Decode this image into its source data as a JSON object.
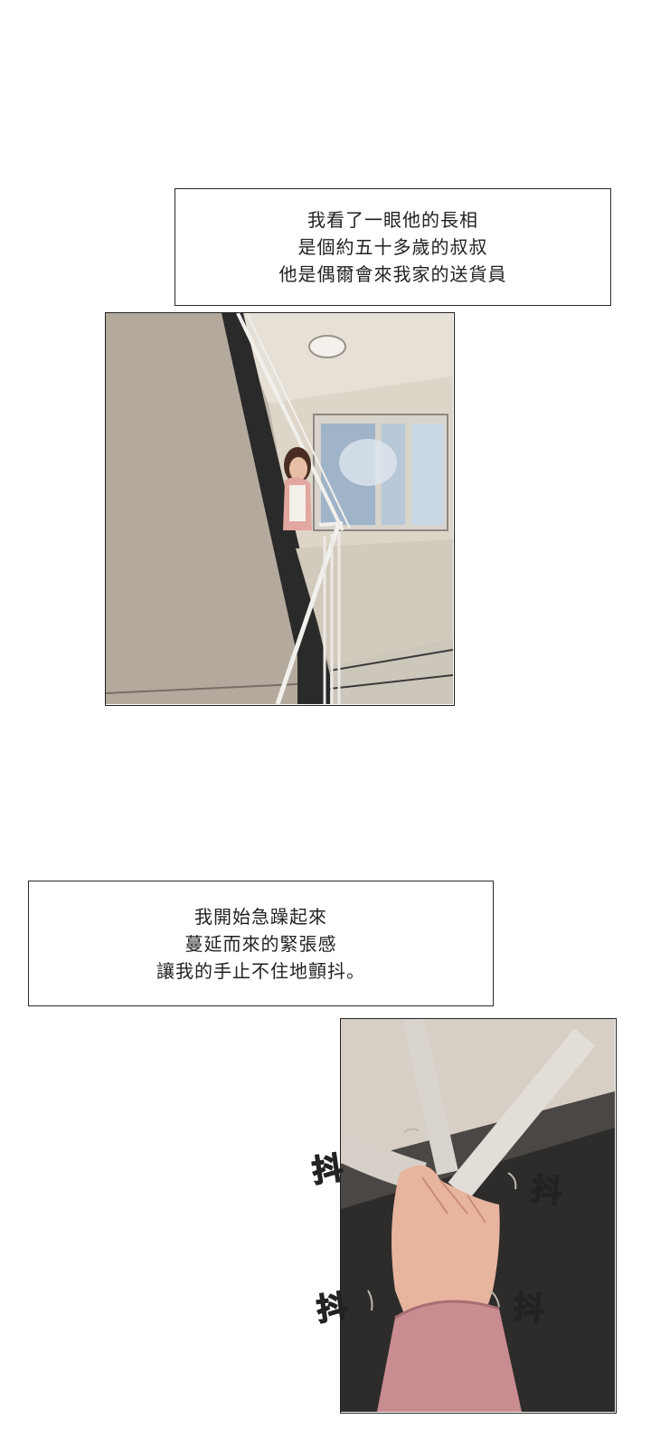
{
  "captions": [
    {
      "lines": [
        "我看了一眼他的長相",
        "是個約五十多歲的叔叔",
        "他是偶爾會來我家的送貨員"
      ]
    },
    {
      "lines": [
        "我開始急躁起來",
        "蔓延而來的緊張感",
        "讓我的手止不住地顫抖。"
      ]
    }
  ],
  "sfx": [
    "抖",
    "抖",
    "抖",
    "抖"
  ]
}
